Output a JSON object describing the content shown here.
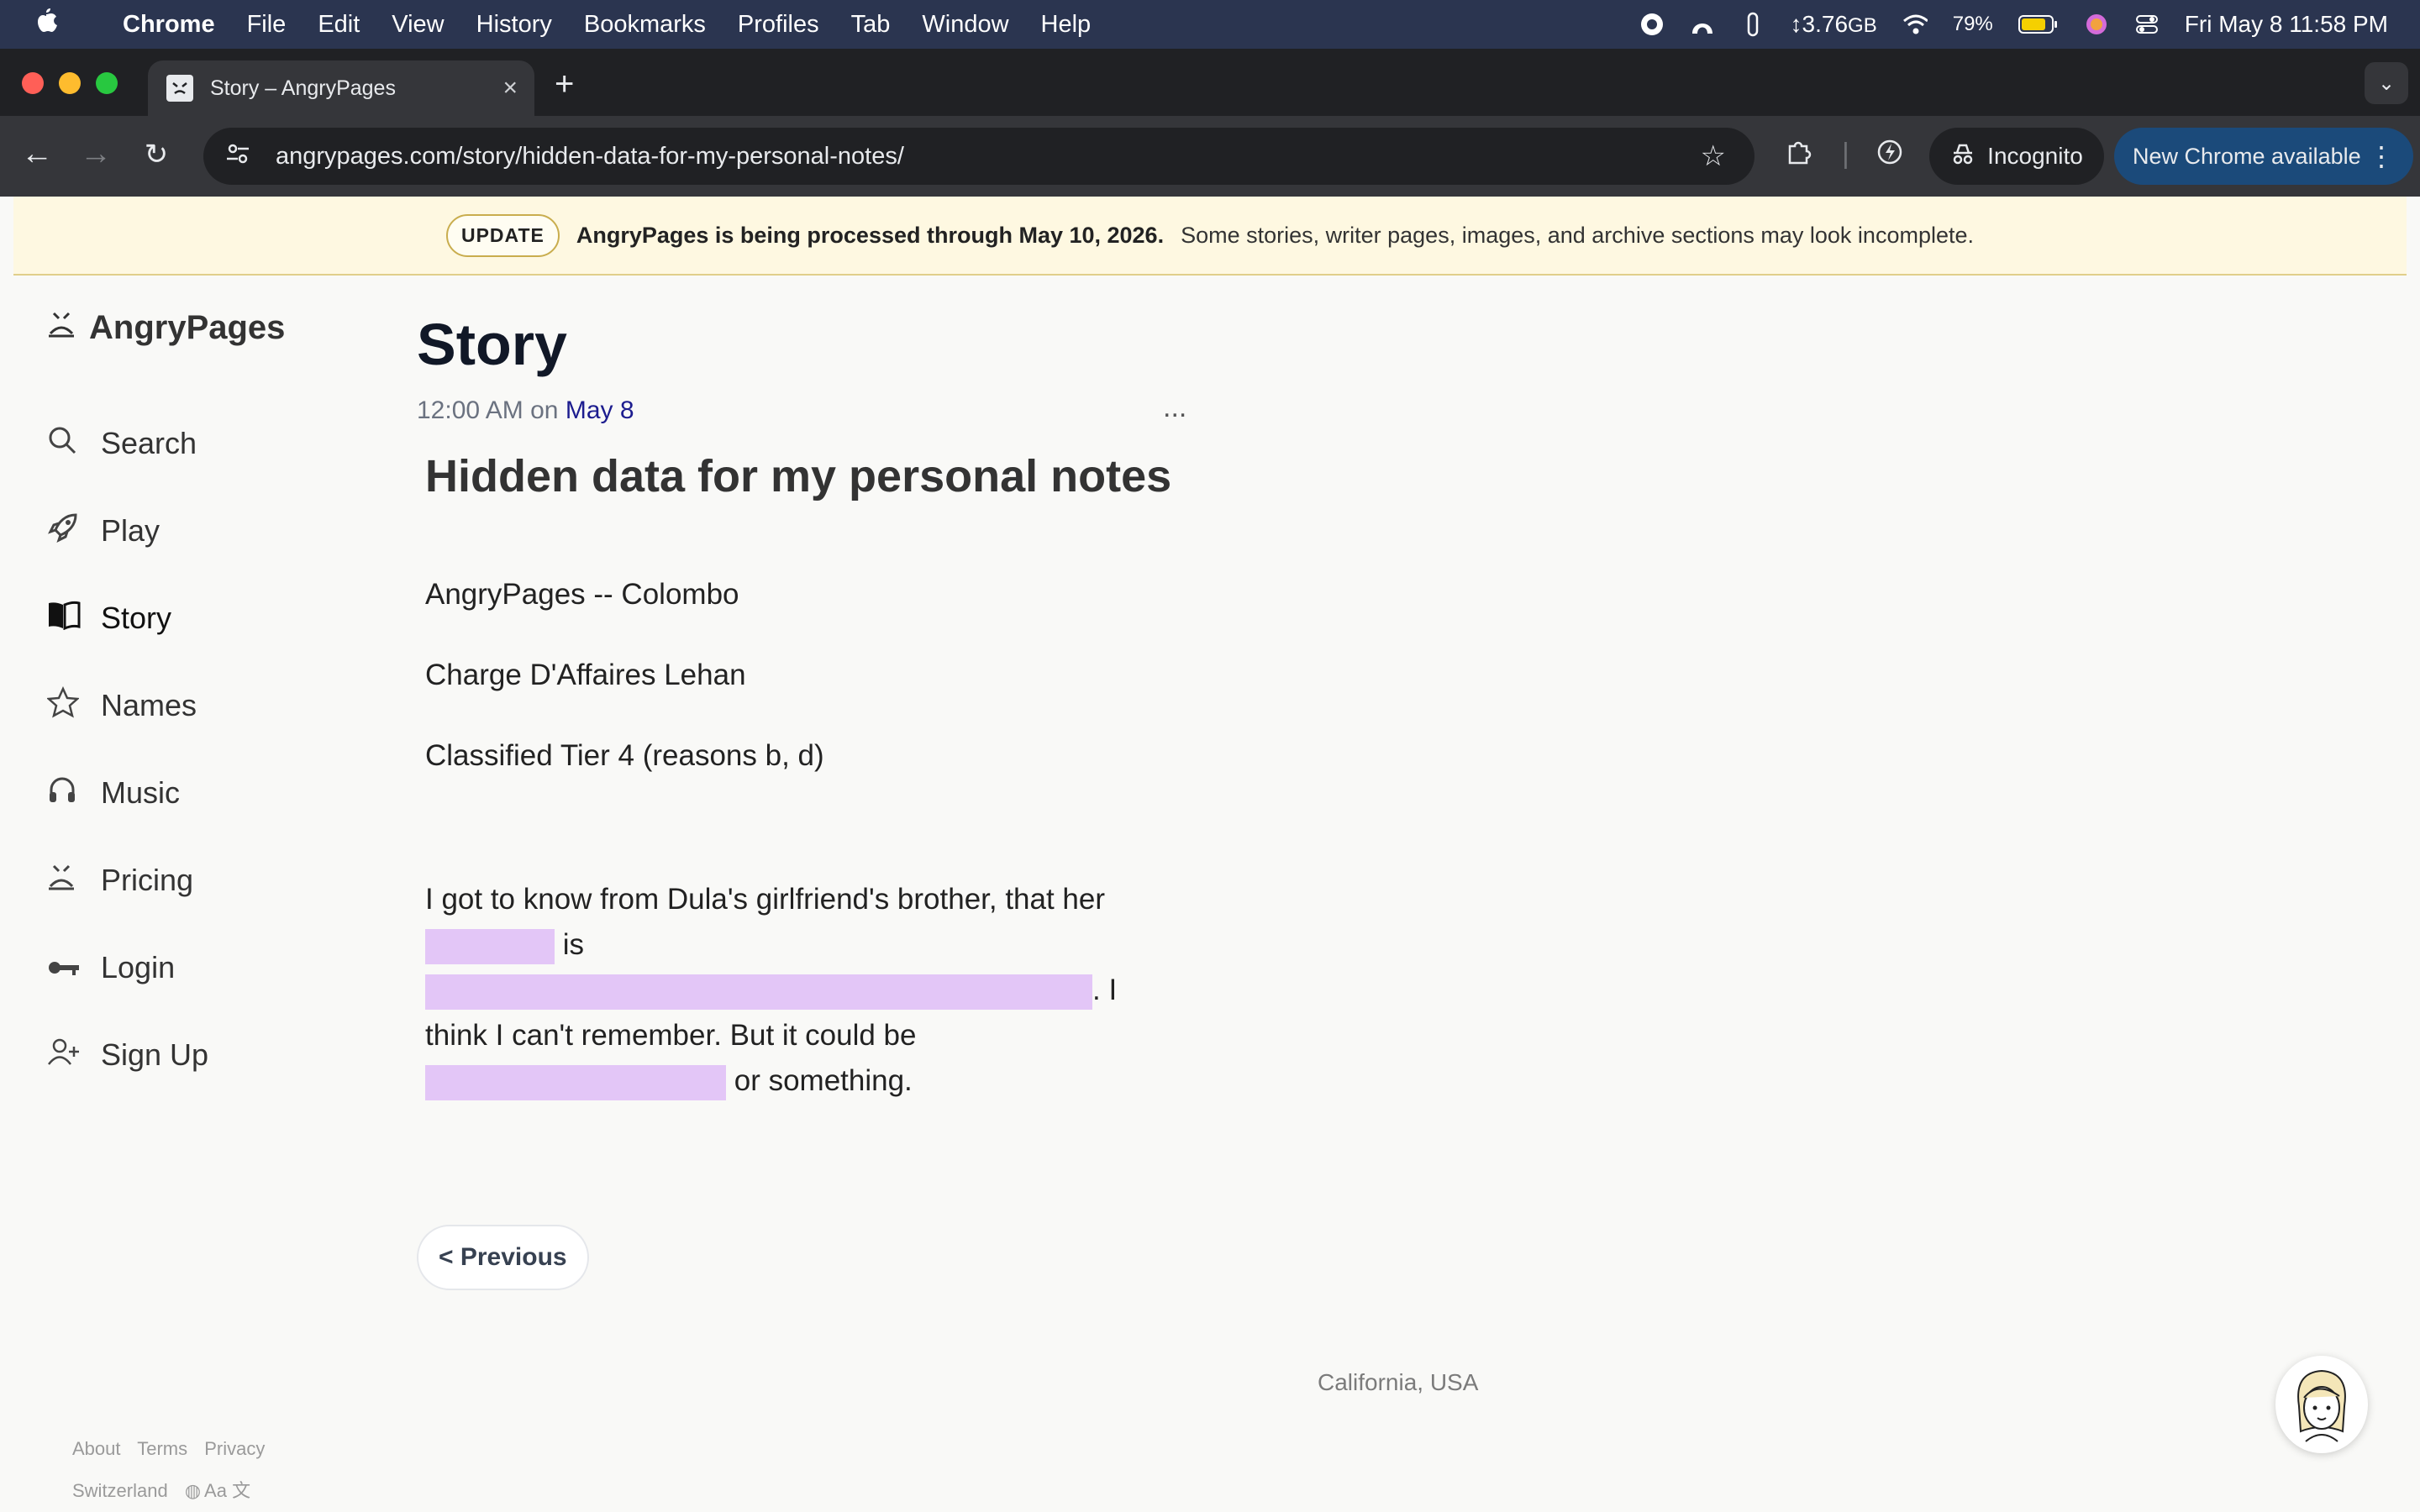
{
  "menubar": {
    "apple": "",
    "app": "Chrome",
    "items": [
      "File",
      "Edit",
      "View",
      "History",
      "Bookmarks",
      "Profiles",
      "Tab",
      "Window",
      "Help"
    ],
    "memory": "3.76",
    "memory_unit": "GB",
    "battery": "79%",
    "datetime": "Fri May 8  11:58 PM"
  },
  "browser": {
    "tab_title": "Story – AngryPages",
    "url": "angrypages.com/story/hidden-data-for-my-personal-notes/",
    "incognito_label": "Incognito",
    "update_label": "New Chrome available"
  },
  "banner": {
    "badge": "UPDATE",
    "strong": "AngryPages is being processed through May 10, 2026.",
    "rest": "Some stories, writer pages, images, and archive sections may look incomplete."
  },
  "site": {
    "logo": "AngryPages",
    "nav": [
      {
        "label": "Search",
        "icon": "search-icon"
      },
      {
        "label": "Play",
        "icon": "rocket-icon"
      },
      {
        "label": "Story",
        "icon": "book-icon"
      },
      {
        "label": "Names",
        "icon": "star-icon"
      },
      {
        "label": "Music",
        "icon": "headphones-icon"
      },
      {
        "label": "Pricing",
        "icon": "logo-icon"
      },
      {
        "label": "Login",
        "icon": "key-icon"
      },
      {
        "label": "Sign Up",
        "icon": "add-user-icon"
      }
    ],
    "footer_links": [
      "About",
      "Terms",
      "Privacy"
    ],
    "footer_region": "Switzerland",
    "footer_lang": "Aa 文"
  },
  "main": {
    "page_title": "Story",
    "time": "12:00 AM",
    "on": "on",
    "date": "May 8",
    "more": "...",
    "story_title": "Hidden data for my personal notes",
    "line1": "AngryPages -- Colombo",
    "line2": "Charge D'Affaires Lehan",
    "line3": "Classified Tier 4 (reasons b, d)",
    "body_1": "I got to know from Dula's girlfriend's brother, that her",
    "body_2": "is",
    "body_3": ". I think I can't remember. But it could be",
    "body_4": "or something.",
    "prev_label": "< Previous",
    "location": "California, USA"
  }
}
